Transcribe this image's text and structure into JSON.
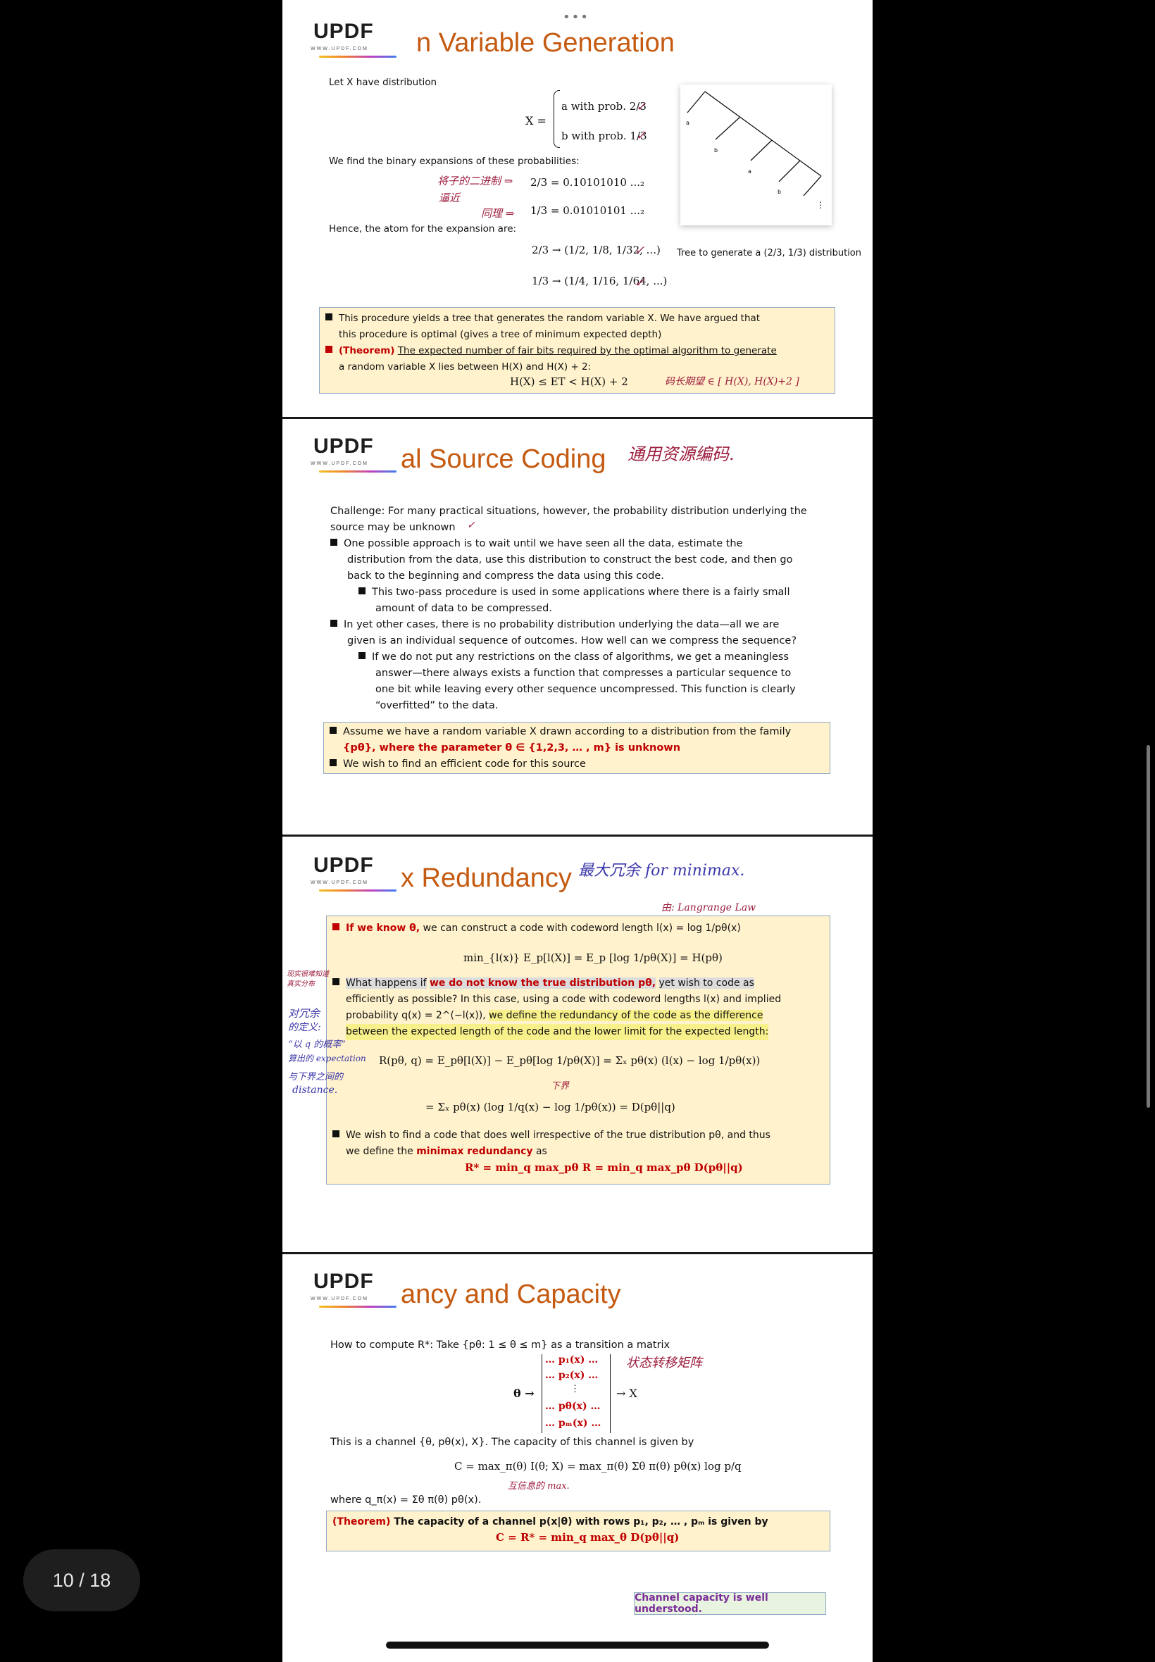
{
  "viewer": {
    "page_indicator": "10 / 18",
    "top_dots": "•••"
  },
  "logo": {
    "text": "UPDF",
    "url": "WWW.UPDF.COM"
  },
  "slide1": {
    "title_visible": "n Variable Generation",
    "intro": "Let X have distribution",
    "x_def": "X =",
    "case_a": "a with prob. 2/3",
    "case_b": "b with prob. 1/3",
    "binary_intro": "We find the binary expansions of these probabilities:",
    "exp_23": "2/3 = 0.10101010 ...₂",
    "exp_13": "1/3 = 0.01010101 ...₂",
    "atoms_intro": "Hence, the atom for the expansion are:",
    "atom_23": "2/3 → (1/2, 1/8, 1/32, ...)",
    "atom_13": "1/3 → (1/4, 1/16, 1/64, ...)",
    "tree_caption": "Tree to generate a (2/3, 1/3) distribution",
    "tree_labels": {
      "a1": "a",
      "b1": "b",
      "a2": "a",
      "b2": "b"
    },
    "box_line1": "This procedure yields a tree that generates the random variable X. We have argued that",
    "box_line2": "this procedure is optimal (gives a tree of minimum expected depth)",
    "box_theorem_label": "(Theorem)",
    "box_line3_rest": "The expected number of fair bits required by the optimal algorithm to generate",
    "box_line4": "a random variable X lies between H(X) and H(X) + 2:",
    "box_formula": "H(X) ≤ ET < H(X) + 2",
    "hand_1": "将子的二进制 ⇒",
    "hand_2": "逼近",
    "hand_3": "同理 ⇒",
    "hand_4": "码长期望 ∈ [ H(X), H(X)+2 ]",
    "check": "✓"
  },
  "slide2": {
    "title_visible": "al Source Coding",
    "title_hand": "通用资源编码.",
    "challenge1": "Challenge: For many practical situations, however, the probability distribution underlying the",
    "challenge2": "source may be unknown",
    "b1_l1": "One possible approach is to wait until we have seen all the data, estimate the",
    "b1_l2": "distribution from the data, use this distribution to construct the best code, and then go",
    "b1_l3": "back to the beginning and compress the data using this code.",
    "b1s_l1": "This two-pass procedure is used in some applications where there is a fairly small",
    "b1s_l2": "amount of data to be compressed.",
    "b2_l1": "In yet other cases, there is no probability distribution underlying the data—all we are",
    "b2_l2": "given is an individual sequence of outcomes. How well can we compress the sequence?",
    "b2s_l1": "If we do not put any restrictions on the class of algorithms, we get a meaningless",
    "b2s_l2": "answer—there always exists a function that compresses a particular sequence to",
    "b2s_l3": "one bit while leaving every other sequence uncompressed. This function is clearly",
    "b2s_l4": "“overfitted” to the data.",
    "box_l1": "Assume we have a random variable X drawn according to a distribution from the family",
    "box_l2": "{pθ}, where the parameter θ ∈ {1,2,3, … , m} is unknown",
    "box_l3": "We wish to find an efficient code for this source"
  },
  "slide3": {
    "title_visible": "x Redundancy",
    "title_hand": "最大冗余 for minimax.",
    "hand_top": "由: Langrange Law",
    "l1_red": "If we know θ,",
    "l1_rest": "we can construct a code with codeword length l(x) = log 1/pθ(x)",
    "formula1": "min_{l(x)} E_p[l(X)] = E_p [log 1/pθ(X)] = H(pθ)",
    "l2_a": "What happens if",
    "l2_red": "we do not know the true distribution pθ,",
    "l2_b": "yet wish to code as",
    "l3": "efficiently as possible? In this case, using a code with codeword lengths l(x) and implied",
    "l4_a": "probability q(x) = 2^(−l(x)),",
    "l4_b": "we define the redundancy of the code as the difference",
    "l5": "between the expected length of the code and the lower limit for the expected length:",
    "formula2": "R(pθ, q) = E_pθ[l(X)] − E_pθ[log 1/pθ(X)] = Σₓ pθ(x) (l(x) − log 1/pθ(x))",
    "formula3": "= Σₓ pθ(x) (log 1/q(x) − log 1/pθ(x)) = D(pθ||q)",
    "l6": "We wish to find a code that does well irrespective of the true distribution pθ, and thus",
    "l7_a": "we define the",
    "l7_red": "minimax redundancy",
    "l7_b": "as",
    "formula4": "R* = min_q max_pθ R = min_q max_pθ D(pθ||q)",
    "margin_1": "现实很难知道",
    "margin_2": "真实分布",
    "margin_3": "对冗余",
    "margin_4": "的定义:",
    "margin_5": "“以 q 的概率”",
    "margin_6": "算出的 expectation",
    "margin_7": "与下界之间的",
    "margin_8": "distance.",
    "hand_lower": "下界"
  },
  "slide4": {
    "title_visible": "ancy and Capacity",
    "intro": "How to compute R*: Take {pθ: 1 ≤ θ ≤ m} as a transition a matrix",
    "theta_arrow": "θ →",
    "x_arrow": "→ X",
    "rows": [
      "… p₁(x) …",
      "… p₂(x) …",
      "⋮",
      "… pθ(x) …",
      "… pₘ(x) …"
    ],
    "hand_matrix": "状态转移矩阵",
    "channel_text": "This is a channel {θ, pθ(x), X}. The capacity of this channel is given by",
    "capacity_formula": "C = max_π(θ) I(θ; X) = max_π(θ) Σθ π(θ) pθ(x) log p/q",
    "hand_capacity": "互信息的 max.",
    "where_text": "where q_π(x) = Σθ π(θ) pθ(x).",
    "theorem_l1_label": "(Theorem)",
    "theorem_l1_rest": "The capacity of a channel p(x|θ) with rows p₁, p₂, … , pₘ is given by",
    "theorem_l2": "C = R* = min_q max_θ D(pθ||q)",
    "note": "Channel capacity is well understood."
  },
  "colors": {
    "title_orange": "#c55a11",
    "theorem_red": "#c00000",
    "box_fill": "#fff2cc",
    "box_border": "#8ea9c6",
    "hand_red": "#9c1c3c",
    "hand_blue": "#3a36a8",
    "note_purple": "#7a2c98"
  }
}
